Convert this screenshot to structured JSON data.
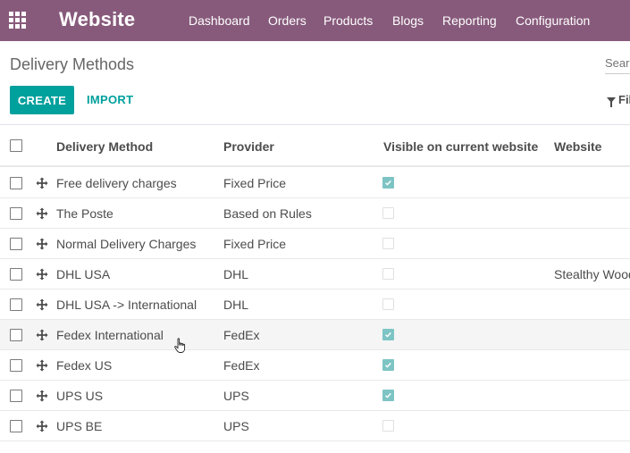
{
  "navbar": {
    "brand": "Website",
    "menu": [
      {
        "label": "Dashboard"
      },
      {
        "label": "Orders"
      },
      {
        "label": "Products"
      },
      {
        "label": "Blogs"
      },
      {
        "label": "Reporting"
      },
      {
        "label": "Configuration"
      }
    ]
  },
  "control_panel": {
    "breadcrumb": "Delivery Methods",
    "search_placeholder": "Search...",
    "create_label": "CREATE",
    "import_label": "IMPORT",
    "filters_label": "Filters"
  },
  "table": {
    "columns": [
      "Delivery Method",
      "Provider",
      "Visible on current website",
      "Website"
    ],
    "rows": [
      {
        "name": "Free delivery charges",
        "provider": "Fixed Price",
        "visible": true,
        "website": ""
      },
      {
        "name": "The Poste",
        "provider": "Based on Rules",
        "visible": false,
        "website": ""
      },
      {
        "name": "Normal Delivery Charges",
        "provider": "Fixed Price",
        "visible": false,
        "website": ""
      },
      {
        "name": "DHL USA",
        "provider": "DHL",
        "visible": false,
        "website": "Stealthy Wood"
      },
      {
        "name": "DHL USA -> International",
        "provider": "DHL",
        "visible": false,
        "website": ""
      },
      {
        "name": "Fedex International",
        "provider": "FedEx",
        "visible": true,
        "website": ""
      },
      {
        "name": "Fedex US",
        "provider": "FedEx",
        "visible": true,
        "website": ""
      },
      {
        "name": "UPS US",
        "provider": "UPS",
        "visible": true,
        "website": ""
      },
      {
        "name": "UPS BE",
        "provider": "UPS",
        "visible": false,
        "website": ""
      }
    ]
  },
  "colors": {
    "navbar": "#875a7b",
    "accent": "#00a09d",
    "checked_visible": "#7ec4c4"
  },
  "icons": [
    "apps-grid-icon",
    "filter-icon",
    "drag-handle-icon",
    "hand-cursor-icon"
  ]
}
